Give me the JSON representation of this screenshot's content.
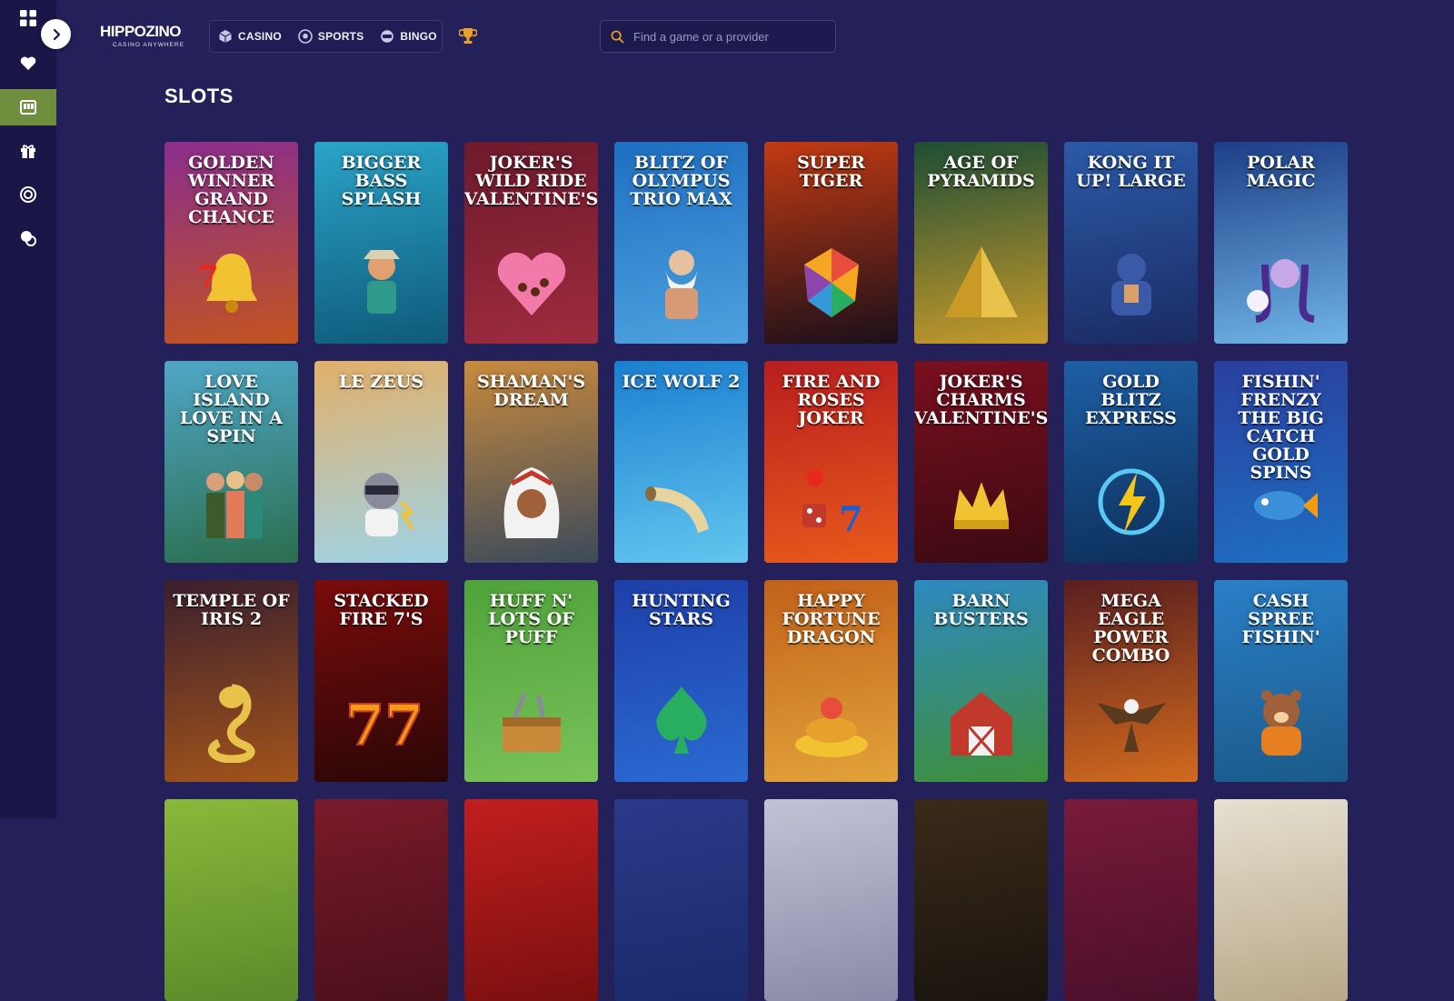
{
  "sidebar": {
    "items": [
      {
        "icon": "grid-icon"
      },
      {
        "icon": "heart-icon"
      },
      {
        "icon": "slots-icon",
        "active": true
      },
      {
        "icon": "gift-icon"
      },
      {
        "icon": "target-icon"
      },
      {
        "icon": "chat-icon"
      }
    ],
    "expand_icon": "chevron-right-icon"
  },
  "header": {
    "logo": {
      "wordmark": "HIPPOZINO",
      "tagline": "CASINO ANYWHERE"
    },
    "tabs": [
      {
        "label": "CASINO",
        "icon": "cube-icon"
      },
      {
        "label": "SPORTS",
        "icon": "soccer-ball-icon"
      },
      {
        "label": "BINGO",
        "icon": "bingo-ball-icon"
      }
    ],
    "trophy_icon": "trophy-icon",
    "search": {
      "placeholder": "Find a game or a provider",
      "icon": "search-icon"
    }
  },
  "main": {
    "section_title": "SLOTS",
    "games": [
      {
        "name": "Golden Winner Grand Chance",
        "art": "bell",
        "bg": [
          "#8a2d8e",
          "#c2541f"
        ]
      },
      {
        "name": "Bigger Bass Splash",
        "art": "fisherman",
        "bg": [
          "#2aa4c8",
          "#0f5a7a"
        ]
      },
      {
        "name": "Joker's Wild Ride Valentine's",
        "art": "heart-box",
        "bg": [
          "#6e1a2c",
          "#9e2b3e"
        ]
      },
      {
        "name": "Blitz of Olympus Trio Max",
        "art": "zeus",
        "bg": [
          "#1f6fc2",
          "#4da1de"
        ]
      },
      {
        "name": "Super Tiger",
        "art": "tiger",
        "bg": [
          "#c23a12",
          "#1b0f1a"
        ]
      },
      {
        "name": "Age of Pyramids",
        "art": "pyramid",
        "bg": [
          "#1e4d35",
          "#c69a2b"
        ]
      },
      {
        "name": "Kong It Up! Large",
        "art": "gorilla",
        "bg": [
          "#2b5aa8",
          "#1b2b63"
        ]
      },
      {
        "name": "Polar Magic",
        "art": "ice-queen",
        "bg": [
          "#1d3e87",
          "#6fb4e6"
        ]
      },
      {
        "name": "Love Island Love in a Spin",
        "art": "couples",
        "bg": [
          "#4fa7c7",
          "#2b6e4f"
        ]
      },
      {
        "name": "Le Zeus",
        "art": "raccoon",
        "bg": [
          "#e2b06a",
          "#9fd3e6"
        ]
      },
      {
        "name": "Shaman's Dream",
        "art": "shaman",
        "bg": [
          "#c98a3d",
          "#3c4a5a"
        ]
      },
      {
        "name": "Ice Wolf 2",
        "art": "horn",
        "bg": [
          "#1b7fd0",
          "#62c6ef"
        ]
      },
      {
        "name": "Fire and Roses Joker",
        "art": "dice",
        "bg": [
          "#b81e1e",
          "#e85a1b"
        ]
      },
      {
        "name": "Joker's Charms Valentine's",
        "art": "crown",
        "bg": [
          "#7a0f1f",
          "#3b0a12"
        ]
      },
      {
        "name": "Gold Blitz Express",
        "art": "lightning",
        "bg": [
          "#1e5fa5",
          "#0d2f5a"
        ]
      },
      {
        "name": "Fishin' Frenzy The Big Catch Gold Spins",
        "art": "fish",
        "bg": [
          "#2a3f9e",
          "#1e6fc2"
        ]
      },
      {
        "name": "Temple of Iris 2",
        "art": "cobra",
        "bg": [
          "#3b1f2e",
          "#a2541a"
        ]
      },
      {
        "name": "Stacked Fire 7's",
        "art": "sevens",
        "bg": [
          "#7a0c0c",
          "#2b0606"
        ]
      },
      {
        "name": "Huff N' Lots of Puff",
        "art": "toolbox",
        "bg": [
          "#4fa33a",
          "#7ac25a"
        ]
      },
      {
        "name": "Hunting Stars",
        "art": "spade",
        "bg": [
          "#1e3fa8",
          "#2a6ad2"
        ]
      },
      {
        "name": "Happy Fortune Dragon",
        "art": "gold-pile",
        "bg": [
          "#c2611a",
          "#e2a33a"
        ]
      },
      {
        "name": "Barn Busters",
        "art": "barn",
        "bg": [
          "#2e8ac2",
          "#3e8f3a"
        ]
      },
      {
        "name": "Mega Eagle Power Combo",
        "art": "eagle",
        "bg": [
          "#5a1f1f",
          "#d16a1e"
        ]
      },
      {
        "name": "Cash Spree Fishin'",
        "art": "bear",
        "bg": [
          "#2a7fc7",
          "#1a5a8a"
        ]
      },
      {
        "name": "",
        "art": "",
        "bg": [
          "#8ab83a",
          "#5a8a2a"
        ]
      },
      {
        "name": "",
        "art": "",
        "bg": [
          "#7a1a2a",
          "#4a0f1a"
        ]
      },
      {
        "name": "",
        "art": "",
        "bg": [
          "#c21e1e",
          "#7a0f0f"
        ]
      },
      {
        "name": "",
        "art": "",
        "bg": [
          "#2a3a8a",
          "#1a2a6a"
        ]
      },
      {
        "name": "",
        "art": "",
        "bg": [
          "#c2c2d6",
          "#8a8aa8"
        ]
      },
      {
        "name": "",
        "art": "",
        "bg": [
          "#3a2a1a",
          "#1a140e"
        ]
      },
      {
        "name": "",
        "art": "",
        "bg": [
          "#7a1a3a",
          "#4a0f2a"
        ]
      },
      {
        "name": "",
        "art": "",
        "bg": [
          "#e6e0d0",
          "#b8a888"
        ]
      }
    ]
  }
}
